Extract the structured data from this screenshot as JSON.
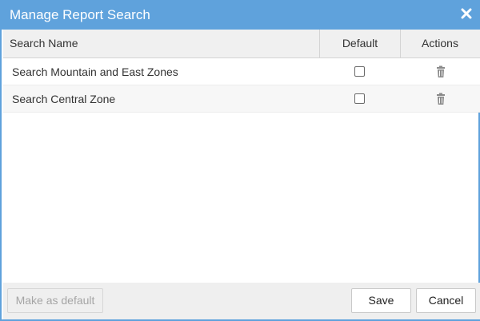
{
  "dialog": {
    "title": "Manage Report Search",
    "close_icon": "close-icon"
  },
  "table": {
    "columns": [
      "Search Name",
      "Default",
      "Actions"
    ],
    "rows": [
      {
        "name": "Search Mountain and East Zones",
        "default": false,
        "action_icon": "trash-icon"
      },
      {
        "name": "Search Central Zone",
        "default": false,
        "action_icon": "trash-icon"
      }
    ]
  },
  "footer": {
    "make_default_label": "Make as default",
    "save_label": "Save",
    "cancel_label": "Cancel"
  },
  "colors": {
    "titlebar": "#5fa2dc",
    "header_bg": "#f0f0f0",
    "footer_bg": "#efefef"
  }
}
